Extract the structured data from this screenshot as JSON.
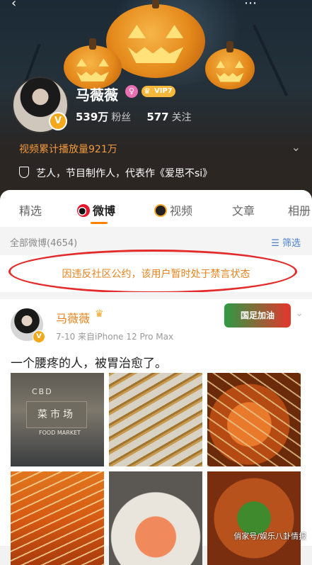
{
  "profile": {
    "name": "马薇薇",
    "gender_symbol": "♀",
    "vip_label": "VIP7",
    "verified_symbol": "V",
    "followers_value": "539万",
    "followers_label": "粉丝",
    "following_value": "577",
    "following_label": "关注",
    "views_text": "视频累计播放量921万",
    "bio": "艺人，节目制作人，代表作《爱思不si》"
  },
  "tabs": [
    {
      "label": "精选"
    },
    {
      "label": "微博"
    },
    {
      "label": "视频"
    },
    {
      "label": "文章"
    },
    {
      "label": "相册"
    }
  ],
  "feed": {
    "count_label": "全部微博(4654)",
    "filter_label": "筛选",
    "ban_notice": "因违反社区公约，该用户暂时处于禁言状态"
  },
  "post": {
    "author": "马薇薇",
    "meta": "7-10  来自iPhone 12 Pro Max",
    "text": "一个腰疼的人，被胃治愈了。",
    "stamp_text": "国足加油",
    "photo1_sign": "菜市场",
    "photo1_cbd": "CBD",
    "photo1_sub": "FOOD MARKET",
    "watermark": "俏家号/娱乐八卦情报"
  },
  "colors": {
    "accent": "#ff8200",
    "ban_text": "#e8831e",
    "highlight_oval": "#e32b2b",
    "link": "#4a7fcf"
  }
}
